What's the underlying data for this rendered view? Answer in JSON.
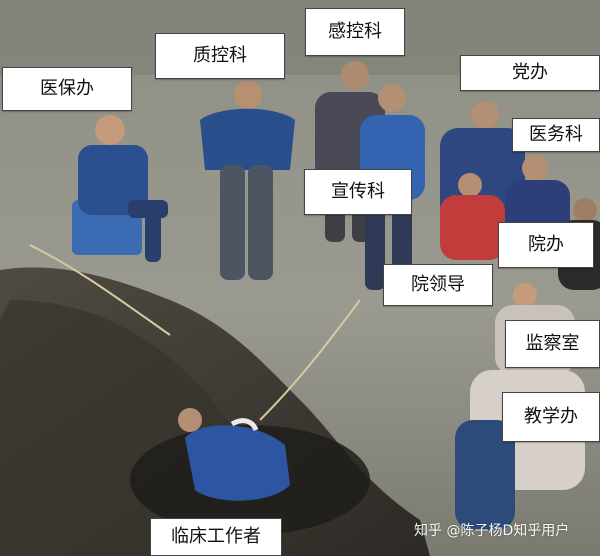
{
  "labels": {
    "medical_insurance_office": "医保办",
    "quality_control": "质控科",
    "infection_control": "感控科",
    "party_office": "党办",
    "medical_affairs": "医务科",
    "publicity": "宣传科",
    "hospital_office": "院办",
    "hospital_leadership": "院领导",
    "supervision_office": "监察室",
    "teaching_office": "教学办",
    "clinical_worker": "临床工作者"
  },
  "watermark": "知乎 @陈子杨D知乎用户",
  "colors": {
    "label_bg": "#ffffff",
    "label_text": "#111111"
  }
}
